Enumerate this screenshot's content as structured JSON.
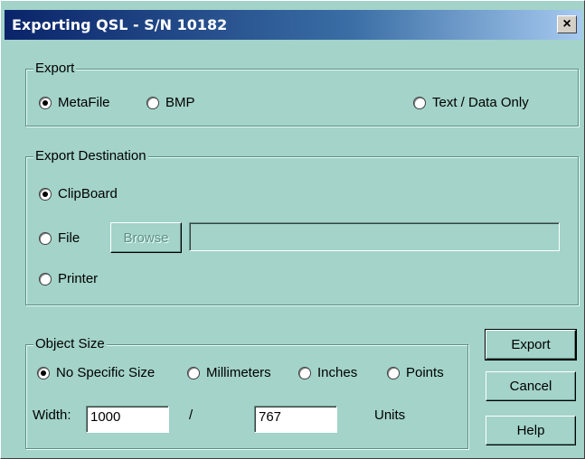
{
  "window": {
    "title": "Exporting QSL - S/N 10182",
    "close_icon": "×"
  },
  "export_group": {
    "legend": "Export",
    "options": [
      "MetaFile",
      "BMP",
      "Text / Data Only"
    ],
    "selected": "MetaFile"
  },
  "destination_group": {
    "legend": "Export Destination",
    "clipboard": "ClipBoard",
    "file": "File",
    "printer": "Printer",
    "browse": "Browse",
    "file_path": "",
    "selected": "ClipBoard"
  },
  "size_group": {
    "legend": "Object Size",
    "options": [
      "No Specific Size",
      "Millimeters",
      "Inches",
      "Points"
    ],
    "selected": "No Specific Size",
    "width_label": "Width:",
    "width_value": "1000",
    "separator": "/",
    "height_value": "767",
    "units_label": "Units"
  },
  "buttons": {
    "export": "Export",
    "cancel": "Cancel",
    "help": "Help"
  },
  "colors": {
    "dialog_bg": "#a3d3c9",
    "title_start": "#0a246a",
    "title_end": "#a6caf0"
  }
}
